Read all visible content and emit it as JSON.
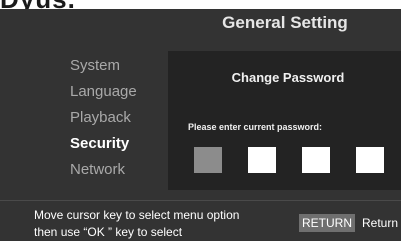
{
  "top_fragment": "Dyus.",
  "title": "General Setting",
  "menu": {
    "items": [
      {
        "label": "System"
      },
      {
        "label": "Language"
      },
      {
        "label": "Playback"
      },
      {
        "label": "Security"
      },
      {
        "label": "Network"
      }
    ],
    "selected": "Security"
  },
  "password_dialog": {
    "title": "Change Password",
    "prompt": "Please enter current password:",
    "box_count": 4,
    "current_box": 1
  },
  "footer": {
    "help_line1": "Move cursor key to select menu option",
    "help_line2": "then use “OK ” key to select",
    "return_key": "RETURN",
    "return_label": "Return"
  }
}
